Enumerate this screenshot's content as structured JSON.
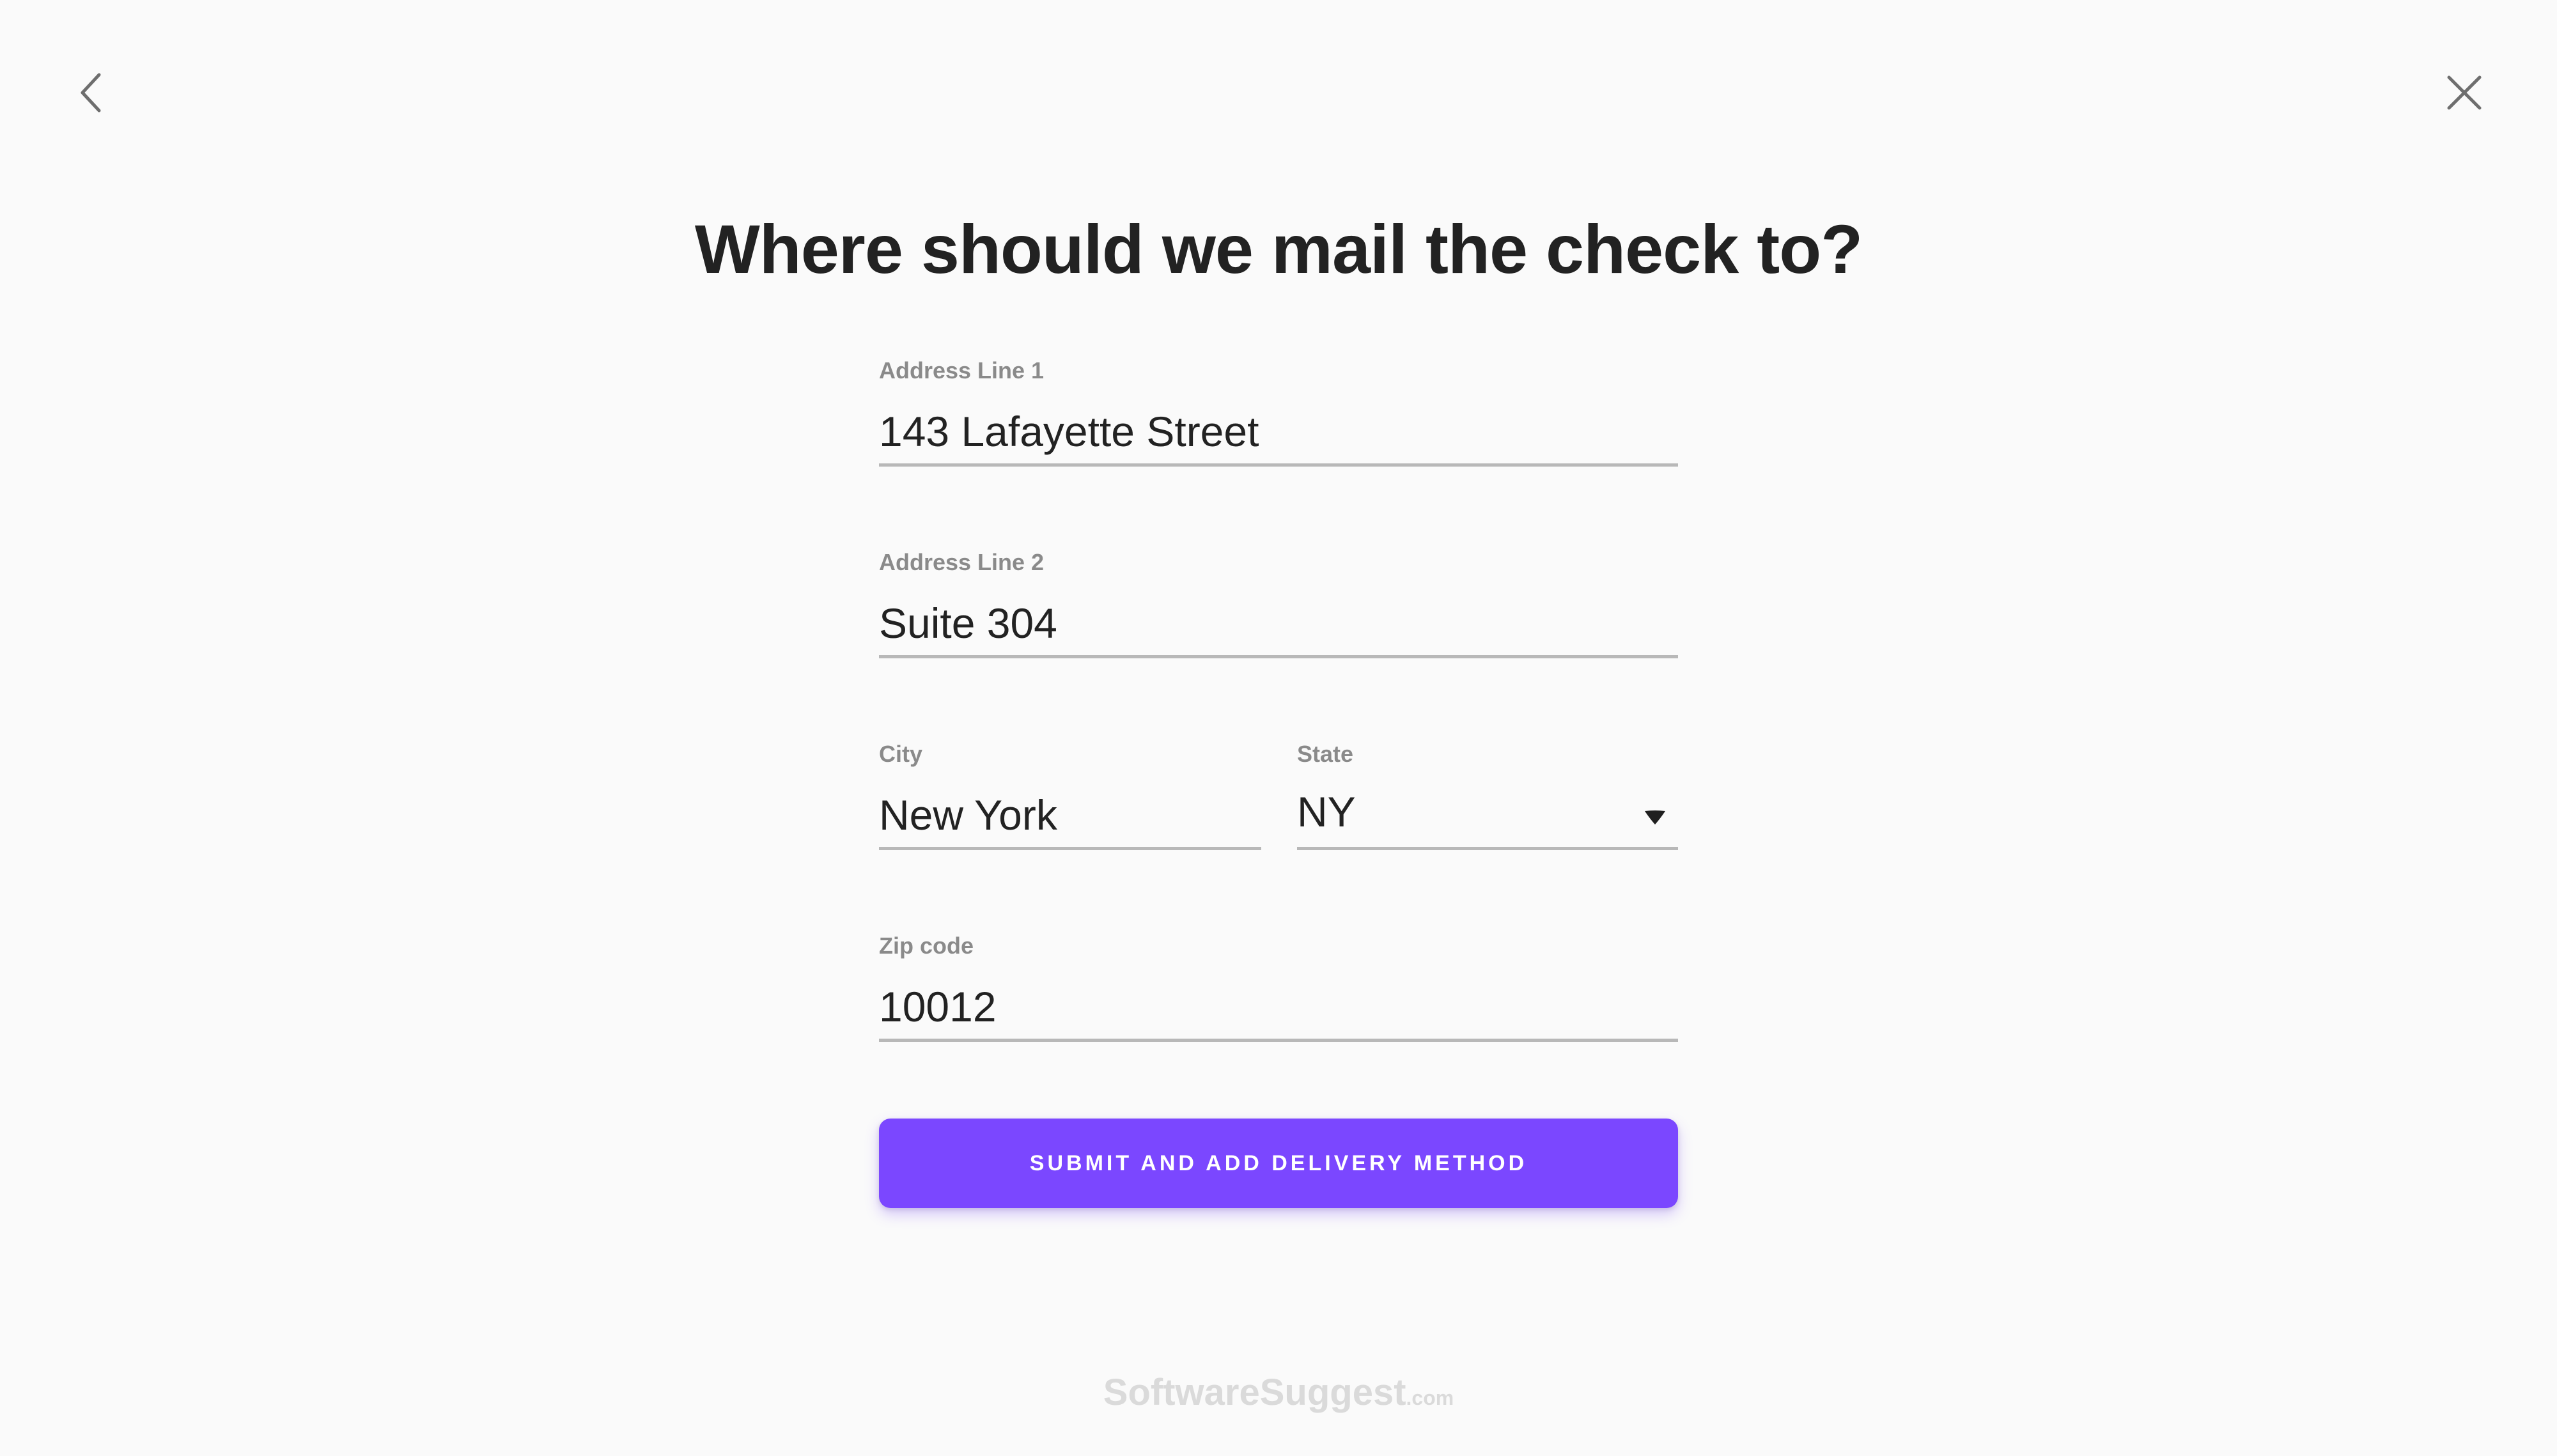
{
  "nav": {
    "back_icon": "chevron-left-icon",
    "close_icon": "close-icon"
  },
  "page": {
    "title": "Where should we mail the check to?"
  },
  "form": {
    "address_line_1": {
      "label": "Address Line 1",
      "value": "143 Lafayette Street"
    },
    "address_line_2": {
      "label": "Address Line 2",
      "value": "Suite 304"
    },
    "city": {
      "label": "City",
      "value": "New York"
    },
    "state": {
      "label": "State",
      "value": "NY",
      "icon": "caret-down-icon"
    },
    "zip_code": {
      "label": "Zip code",
      "value": "10012"
    }
  },
  "actions": {
    "submit_label": "SUBMIT AND ADD DELIVERY METHOD"
  },
  "watermark": {
    "brand": "SoftwareSuggest",
    "suffix": ".com"
  },
  "colors": {
    "background": "#fafafa",
    "accent": "#7b47ff",
    "title": "#222222",
    "label": "#8a8a8a",
    "underline": "#b8b8b8",
    "icon": "#6e6e6e"
  }
}
